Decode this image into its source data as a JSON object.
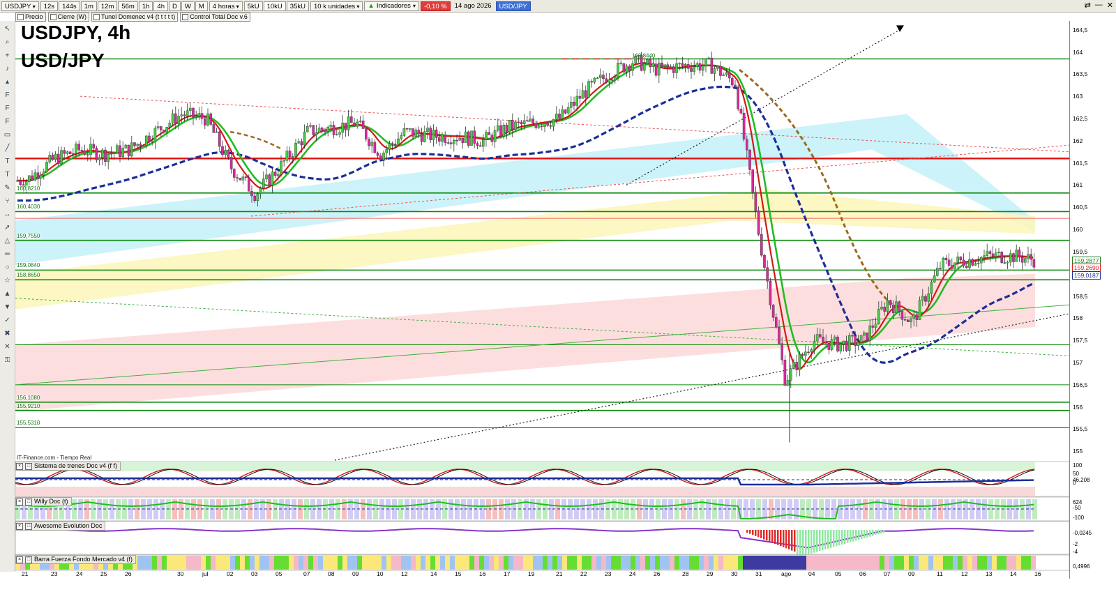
{
  "toolbar": {
    "symbol": "USDJPY",
    "timeframes": [
      "12s",
      "144s",
      "1m",
      "12m",
      "56m",
      "1h",
      "4h",
      "D",
      "W",
      "M"
    ],
    "period_select": "4 horas",
    "units": [
      "5kU",
      "10kU",
      "35kU"
    ],
    "units_select": "10 k unidades",
    "indicators_label": "Indicadores",
    "change_badge": "-0,10 %",
    "date": "14 ago 2026",
    "pair_badge": "USD/JPY"
  },
  "legend_row": [
    "Precio",
    "Cierre (W)",
    "Tunel Domenec v4 (t t t t t)",
    "Control Total Doc v.6"
  ],
  "chart_title": "USDJPY, 4h",
  "chart_subtitle": "USD/JPY",
  "source_label": "IT-Finance.com - Tiempo Real",
  "panels": [
    {
      "title": "Sistema de trenes Doc v4 (f f)"
    },
    {
      "title": "Willy Doc (t)"
    },
    {
      "title": "Awesome Evolution Doc"
    },
    {
      "title": "Barra Fuerza Fondo Mercado v4 (f)"
    }
  ],
  "panel_axis_labels": {
    "trenes": [
      "100",
      "50",
      "0",
      "46,208"
    ],
    "willy": [
      "-50",
      "-100",
      "624"
    ],
    "awesome": [
      "-0,0245",
      "-2",
      "-4"
    ],
    "barra": [
      "0,4996"
    ]
  },
  "price_ticks": [
    "164,5",
    "164",
    "163,5",
    "163",
    "162,5",
    "162",
    "161,5",
    "161",
    "160,5",
    "160",
    "159,5",
    "159",
    "158,5",
    "158",
    "157,5",
    "157",
    "156,5",
    "156",
    "155,5",
    "155"
  ],
  "price_tags": [
    {
      "text": "159,2877",
      "color": "#1a7a1a"
    },
    {
      "text": "159,2690",
      "color": "#d21d1d"
    },
    {
      "text": "159,0187",
      "color": "#1c2e99"
    }
  ],
  "level_labels": [
    "163,8440",
    "160,8210",
    "160,4030",
    "159,7550",
    "159,0840",
    "158,8650",
    "156,1080",
    "155,9210",
    "155,5310"
  ],
  "x_ticks": [
    "21",
    "23",
    "24",
    "25",
    "26",
    "30",
    "jul",
    "02",
    "03",
    "05",
    "07",
    "08",
    "09",
    "10",
    "12",
    "14",
    "15",
    "16",
    "17",
    "19",
    "21",
    "22",
    "23",
    "24",
    "26",
    "28",
    "29",
    "30",
    "31",
    "ago",
    "04",
    "05",
    "06",
    "07",
    "09",
    "11",
    "12",
    "13",
    "14",
    "16"
  ],
  "colors": {
    "support": "#0a8a0a",
    "resistance": "#e01515",
    "ma_fast": "#d11a1a",
    "ma_green": "#22bb22",
    "ma_blue": "#1c2e99",
    "ma_brown": "#9a6a1c"
  },
  "chart_data": {
    "type": "candlestick",
    "title": "USDJPY, 4h",
    "subtitle": "USD/JPY",
    "ylim": [
      154.8,
      164.7
    ],
    "horizontal_levels": [
      163.844,
      161.6,
      160.821,
      160.403,
      160.25,
      159.755,
      159.084,
      158.865,
      157.4,
      156.5,
      156.108,
      155.921,
      155.531
    ],
    "close_path": [
      [
        "21",
        161.1
      ],
      [
        "23",
        161.6
      ],
      [
        "24",
        161.8
      ],
      [
        "25",
        161.7
      ],
      [
        "26",
        161.8
      ],
      [
        "30",
        162.6
      ],
      [
        "jul",
        162.5
      ],
      [
        "02",
        161.4
      ],
      [
        "03",
        160.8
      ],
      [
        "05",
        161.4
      ],
      [
        "07",
        162.2
      ],
      [
        "08",
        162.3
      ],
      [
        "09",
        162.4
      ],
      [
        "10",
        161.7
      ],
      [
        "12",
        162.2
      ],
      [
        "14",
        162.1
      ],
      [
        "15",
        162.1
      ],
      [
        "16",
        162.0
      ],
      [
        "17",
        162.3
      ],
      [
        "19",
        162.4
      ],
      [
        "21",
        162.5
      ],
      [
        "22",
        163.1
      ],
      [
        "23",
        163.5
      ],
      [
        "24",
        163.8
      ],
      [
        "26",
        163.6
      ],
      [
        "28",
        163.7
      ],
      [
        "29",
        163.7
      ],
      [
        "30",
        163.3
      ],
      [
        "31",
        159.8
      ],
      [
        "ago",
        156.6
      ],
      [
        "04",
        157.5
      ],
      [
        "05",
        157.4
      ],
      [
        "06",
        157.5
      ],
      [
        "07",
        158.4
      ],
      [
        "09",
        157.9
      ],
      [
        "11",
        159.2
      ],
      [
        "12",
        159.3
      ],
      [
        "13",
        159.4
      ],
      [
        "14",
        159.4
      ],
      [
        "16",
        159.3
      ]
    ],
    "annotations": [
      "163,8440"
    ]
  }
}
